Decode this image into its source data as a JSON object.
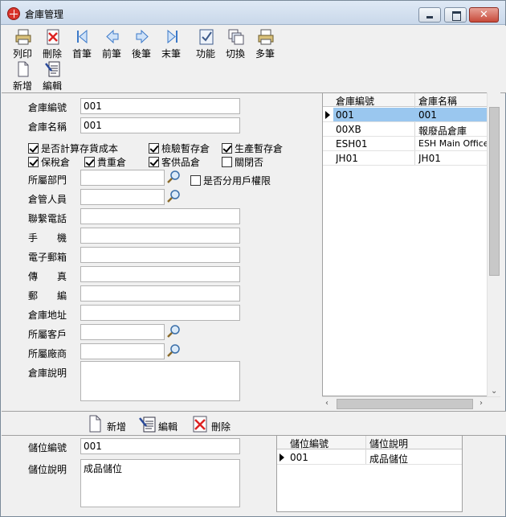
{
  "window": {
    "title": "倉庫管理"
  },
  "toolbar": {
    "print": "列印",
    "delete": "刪除",
    "first": "首筆",
    "prev": "前筆",
    "next": "後筆",
    "last": "末筆",
    "function": "功能",
    "switch": "切換",
    "multi": "多筆",
    "add": "新增",
    "edit": "編輯"
  },
  "form": {
    "code_label": "倉庫編號",
    "code_value": "001",
    "name_label": "倉庫名稱",
    "name_value": "001",
    "cb_cost": "是否計算存貨成本",
    "cb_inspect": "檢驗暫存倉",
    "cb_production": "生產暫存倉",
    "cb_bonded": "保稅倉",
    "cb_valuable": "貴重倉",
    "cb_customer": "客供品倉",
    "cb_closed": "關閉否",
    "dept_label": "所屬部門",
    "cb_user_perm": "是否分用戶權限",
    "keeper_label": "倉管人員",
    "phone_label": "聯繫電話",
    "mobile_label": "手　　機",
    "email_label": "電子郵箱",
    "fax_label": "傳　　真",
    "zip_label": "郵　　編",
    "address_label": "倉庫地址",
    "customer_label": "所屬客戶",
    "vendor_label": "所屬廠商",
    "desc_label": "倉庫說明"
  },
  "warehouse_grid": {
    "col_code": "倉庫編號",
    "col_name": "倉庫名稱",
    "rows": [
      {
        "code": "001",
        "name": "001"
      },
      {
        "code": "00XB",
        "name": "報廢品倉庫"
      },
      {
        "code": "ESH01",
        "name": "ESH Main Office"
      },
      {
        "code": "JH01",
        "name": "JH01"
      }
    ]
  },
  "bottom_toolbar": {
    "add": "新增",
    "edit": "編輯",
    "delete": "刪除"
  },
  "location": {
    "code_label": "儲位編號",
    "code_value": "001",
    "desc_label": "儲位說明",
    "desc_value": "成品儲位"
  },
  "location_grid": {
    "col_code": "儲位編號",
    "col_desc": "儲位說明",
    "rows": [
      {
        "code": "001",
        "desc": "成品儲位"
      }
    ]
  }
}
